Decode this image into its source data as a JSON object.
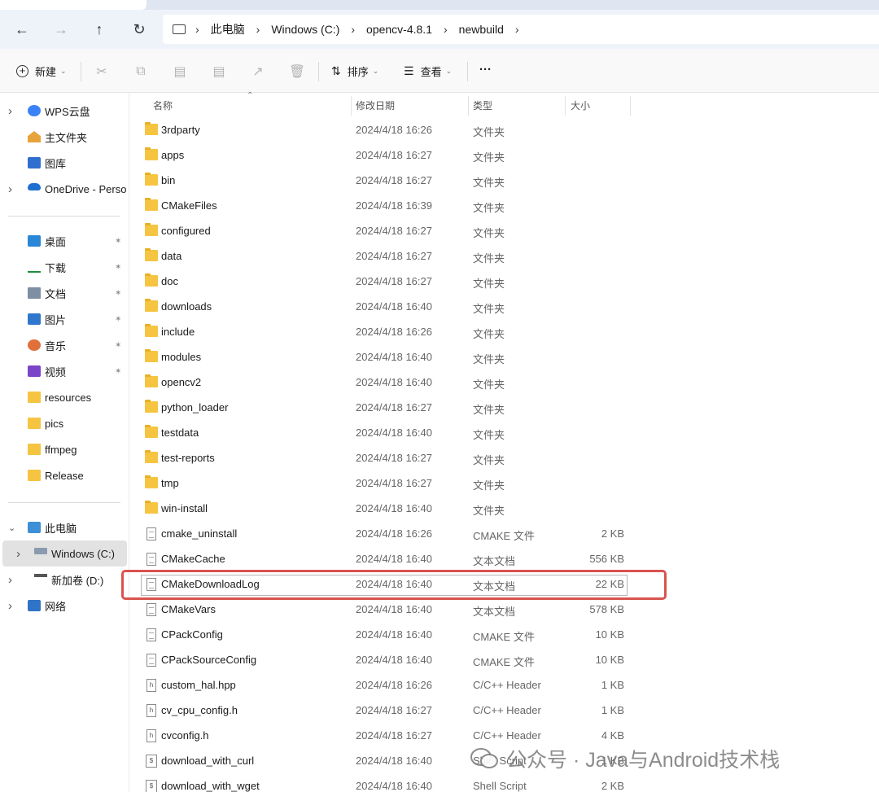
{
  "breadcrumb": [
    "此电脑",
    "Windows (C:)",
    "opencv-4.8.1",
    "newbuild"
  ],
  "toolbar": {
    "new_label": "新建",
    "sort_label": "排序",
    "view_label": "查看",
    "more_label": "···"
  },
  "sidebar": {
    "quick": [
      {
        "label": "WPS云盘",
        "icon": "wps-cloud-icon",
        "chevron": true
      },
      {
        "label": "主文件夹",
        "icon": "home-icon",
        "chevron": false
      },
      {
        "label": "图库",
        "icon": "gallery-icon",
        "chevron": false
      },
      {
        "label": "OneDrive - Perso",
        "icon": "onedrive-icon",
        "chevron": true
      }
    ],
    "pinned": [
      {
        "label": "桌面",
        "icon": "desktop-icon",
        "pinned": true
      },
      {
        "label": "下载",
        "icon": "download-icon",
        "pinned": true
      },
      {
        "label": "文档",
        "icon": "documents-icon",
        "pinned": true
      },
      {
        "label": "图片",
        "icon": "pictures-icon",
        "pinned": true
      },
      {
        "label": "音乐",
        "icon": "music-icon",
        "pinned": true
      },
      {
        "label": "视频",
        "icon": "videos-icon",
        "pinned": true
      },
      {
        "label": "resources",
        "icon": "folder-icon",
        "pinned": false
      },
      {
        "label": "pics",
        "icon": "folder-icon",
        "pinned": false
      },
      {
        "label": "ffmpeg",
        "icon": "folder-icon",
        "pinned": false
      },
      {
        "label": "Release",
        "icon": "folder-icon",
        "pinned": false
      }
    ],
    "pc": [
      {
        "label": "此电脑",
        "icon": "pc-icon",
        "chevron": "down"
      },
      {
        "label": "Windows (C:)",
        "icon": "windows-drive-icon",
        "chevron": "right",
        "selected": true
      },
      {
        "label": "新加卷 (D:)",
        "icon": "drive-icon",
        "chevron": "right"
      },
      {
        "label": "网络",
        "icon": "network-icon",
        "chevron": "right"
      }
    ]
  },
  "columns": {
    "name": "名称",
    "date": "修改日期",
    "type": "类型",
    "size": "大小"
  },
  "files": [
    {
      "name": "3rdparty",
      "date": "2024/4/18 16:26",
      "type": "文件夹",
      "size": "",
      "kind": "folder"
    },
    {
      "name": "apps",
      "date": "2024/4/18 16:27",
      "type": "文件夹",
      "size": "",
      "kind": "folder"
    },
    {
      "name": "bin",
      "date": "2024/4/18 16:27",
      "type": "文件夹",
      "size": "",
      "kind": "folder"
    },
    {
      "name": "CMakeFiles",
      "date": "2024/4/18 16:39",
      "type": "文件夹",
      "size": "",
      "kind": "folder"
    },
    {
      "name": "configured",
      "date": "2024/4/18 16:27",
      "type": "文件夹",
      "size": "",
      "kind": "folder"
    },
    {
      "name": "data",
      "date": "2024/4/18 16:27",
      "type": "文件夹",
      "size": "",
      "kind": "folder"
    },
    {
      "name": "doc",
      "date": "2024/4/18 16:27",
      "type": "文件夹",
      "size": "",
      "kind": "folder"
    },
    {
      "name": "downloads",
      "date": "2024/4/18 16:40",
      "type": "文件夹",
      "size": "",
      "kind": "folder"
    },
    {
      "name": "include",
      "date": "2024/4/18 16:26",
      "type": "文件夹",
      "size": "",
      "kind": "folder"
    },
    {
      "name": "modules",
      "date": "2024/4/18 16:40",
      "type": "文件夹",
      "size": "",
      "kind": "folder"
    },
    {
      "name": "opencv2",
      "date": "2024/4/18 16:40",
      "type": "文件夹",
      "size": "",
      "kind": "folder"
    },
    {
      "name": "python_loader",
      "date": "2024/4/18 16:27",
      "type": "文件夹",
      "size": "",
      "kind": "folder"
    },
    {
      "name": "testdata",
      "date": "2024/4/18 16:40",
      "type": "文件夹",
      "size": "",
      "kind": "folder"
    },
    {
      "name": "test-reports",
      "date": "2024/4/18 16:27",
      "type": "文件夹",
      "size": "",
      "kind": "folder"
    },
    {
      "name": "tmp",
      "date": "2024/4/18 16:27",
      "type": "文件夹",
      "size": "",
      "kind": "folder"
    },
    {
      "name": "win-install",
      "date": "2024/4/18 16:40",
      "type": "文件夹",
      "size": "",
      "kind": "folder"
    },
    {
      "name": "cmake_uninstall",
      "date": "2024/4/18 16:26",
      "type": "CMAKE 文件",
      "size": "2 KB",
      "kind": "doc"
    },
    {
      "name": "CMakeCache",
      "date": "2024/4/18 16:40",
      "type": "文本文档",
      "size": "556 KB",
      "kind": "doc"
    },
    {
      "name": "CMakeDownloadLog",
      "date": "2024/4/18 16:40",
      "type": "文本文档",
      "size": "22 KB",
      "kind": "doc",
      "highlighted": true
    },
    {
      "name": "CMakeVars",
      "date": "2024/4/18 16:40",
      "type": "文本文档",
      "size": "578 KB",
      "kind": "doc"
    },
    {
      "name": "CPackConfig",
      "date": "2024/4/18 16:40",
      "type": "CMAKE 文件",
      "size": "10 KB",
      "kind": "doc"
    },
    {
      "name": "CPackSourceConfig",
      "date": "2024/4/18 16:40",
      "type": "CMAKE 文件",
      "size": "10 KB",
      "kind": "doc"
    },
    {
      "name": "custom_hal.hpp",
      "date": "2024/4/18 16:26",
      "type": "C/C++ Header",
      "size": "1 KB",
      "kind": "header"
    },
    {
      "name": "cv_cpu_config.h",
      "date": "2024/4/18 16:27",
      "type": "C/C++ Header",
      "size": "1 KB",
      "kind": "header"
    },
    {
      "name": "cvconfig.h",
      "date": "2024/4/18 16:27",
      "type": "C/C++ Header",
      "size": "4 KB",
      "kind": "header"
    },
    {
      "name": "download_with_curl",
      "date": "2024/4/18 16:40",
      "type": "Shell Script",
      "size": "1 KB",
      "kind": "script"
    },
    {
      "name": "download_with_wget",
      "date": "2024/4/18 16:40",
      "type": "Shell Script",
      "size": "2 KB",
      "kind": "script"
    }
  ],
  "watermark": "公众号 · Java与Android技术栈",
  "colors": {
    "highlight": "#d9534f",
    "folder": "#f5c542",
    "selected_bg": "#e2e2e2"
  }
}
